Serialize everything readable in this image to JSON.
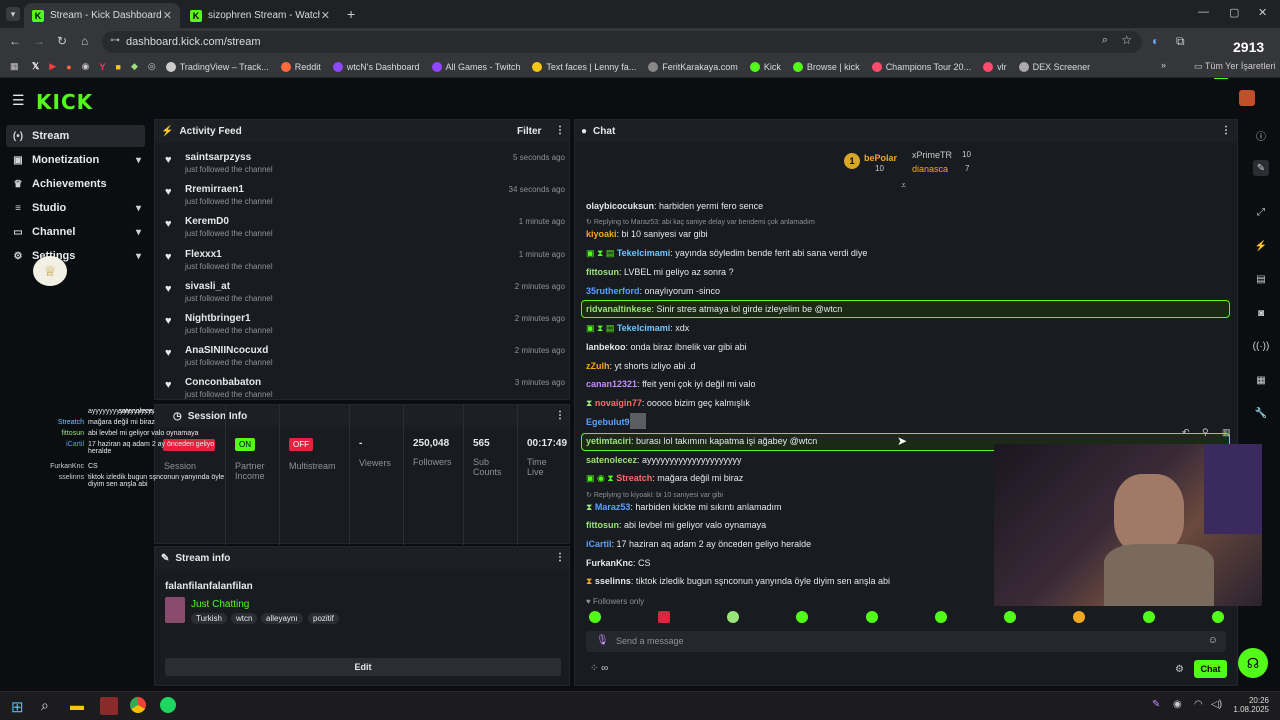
{
  "browser": {
    "tabs": [
      {
        "title": "Stream - Kick Dashboard",
        "active": true
      },
      {
        "title": "sizophren Stream - Watch Live",
        "active": false
      }
    ],
    "url": "dashboard.kick.com/stream",
    "bookmarks": [
      "TradingView – Track...",
      "Reddit",
      "wtcN's Dashboard",
      "All Games - Twitch",
      "Text faces | Lenny fa...",
      "FeritKarakaya.com",
      "Kick",
      "Browse | kick",
      "Champions Tour 20...",
      "vlr",
      "DEX Screener"
    ],
    "all_bookmarks_label": "Tüm Yer İşaretleri",
    "overlay_count": "2913"
  },
  "brand": {
    "logo": "KICK",
    "accent": "#53fc18"
  },
  "sidebar": {
    "items": [
      {
        "label": "Stream",
        "icon": "radio-icon",
        "active": true
      },
      {
        "label": "Monetization",
        "icon": "money-icon",
        "chevron": true
      },
      {
        "label": "Achievements",
        "icon": "trophy-icon"
      },
      {
        "label": "Studio",
        "icon": "sliders-icon",
        "chevron": true
      },
      {
        "label": "Channel",
        "icon": "tv-icon",
        "chevron": true
      },
      {
        "label": "Settings",
        "icon": "gear-icon",
        "chevron": true
      }
    ]
  },
  "activity_feed": {
    "title": "Activity Feed",
    "filter_label": "Filter",
    "items": [
      {
        "name": "saintsarpzyss",
        "action": "just followed the channel",
        "time": "5 seconds ago"
      },
      {
        "name": "Rremirraen1",
        "action": "just followed the channel",
        "time": "34 seconds ago"
      },
      {
        "name": "KeremD0",
        "action": "just followed the channel",
        "time": "1 minute ago"
      },
      {
        "name": "Flexxx1",
        "action": "just followed the channel",
        "time": "1 minute ago"
      },
      {
        "name": "sivasli_at",
        "action": "just followed the channel",
        "time": "2 minutes ago"
      },
      {
        "name": "Nightbringer1",
        "action": "just followed the channel",
        "time": "2 minutes ago"
      },
      {
        "name": "AnaSINIINcocuxd",
        "action": "just followed the channel",
        "time": "2 minutes ago"
      },
      {
        "name": "Conconbabaton",
        "action": "just followed the channel",
        "time": "3 minutes ago"
      }
    ]
  },
  "session_info": {
    "title": "Session Info",
    "stats": [
      {
        "label": "Session",
        "value": ""
      },
      {
        "label": "Partner Income",
        "value": "ON"
      },
      {
        "label": "Multistream",
        "value": "OFF"
      },
      {
        "label": "Viewers",
        "value": "-"
      },
      {
        "label": "Followers",
        "value": "250,048"
      },
      {
        "label": "Sub Counts",
        "value": "565"
      },
      {
        "label": "Time Live",
        "value": "00:17:49"
      }
    ]
  },
  "stream_info": {
    "title": "Stream info",
    "stream_title": "falanfilanfalanfilan",
    "category": "Just Chatting",
    "tags": [
      "Turkish",
      "wtcn",
      "alleyaynı",
      "pozitif"
    ],
    "edit_label": "Edit"
  },
  "overlay_chat": [
    {
      "name": "satenolecez",
      "msg": "ayyyyyyyyyyyyyyyyyyy"
    },
    {
      "name": "Streatch",
      "msg": "mağara değil mi biraz"
    },
    {
      "name": "fittosun",
      "msg": "abi levbel mi geliyor valo oynamaya"
    },
    {
      "name": "iCartil",
      "msg": "17 haziran aq adam 2 ay önceden geliyo heralde"
    },
    {
      "name": "FurkanKnc",
      "msg": "CS"
    },
    {
      "name": "sselinns",
      "msg": "tiktok izledik bugun sşnconun yanyında öyle diyim sen anşla abi"
    }
  ],
  "chat": {
    "title": "Chat",
    "leaderboard": [
      {
        "rank": "1",
        "name": "bePolar",
        "value": "10"
      },
      {
        "name": "xPrimeTR",
        "value": "10"
      },
      {
        "name": "dianasca",
        "value": "7"
      }
    ],
    "messages": [
      {
        "user": "olaybicocuksun",
        "text": "harbiden yermi fero sence",
        "color": "#e6e8ea"
      },
      {
        "reply": "Replying to Maraz53: abi kaç saniye delay var bendemi çok anlamadım"
      },
      {
        "user": "kiyoaki",
        "text": "bi 10 saniyesi var gibi",
        "color": "#f5a623"
      },
      {
        "user": "Tekelcimami",
        "text": "yayında söyledim bende ferit abi sana verdi diye",
        "color": "#6ec6ff"
      },
      {
        "user": "fittosun",
        "text": "LVBEL mi geliyo az sonra ?",
        "color": "#9be37a"
      },
      {
        "user": "35rutherford",
        "text": "onaylıyorum -sinco",
        "color": "#5aa0ff"
      },
      {
        "user": "ridvanaltinkese",
        "text": "Sinir stres atmaya lol girde izleyelim be @wtcn",
        "color": "#9be37a",
        "highlight": true
      },
      {
        "user": "Tekelcimami",
        "text": "xdx",
        "color": "#6ec6ff"
      },
      {
        "user": "lanbekoo",
        "text": "onda biraz ibnelik var gibi abi",
        "color": "#e6e8ea"
      },
      {
        "user": "zZulh",
        "text": "yt shorts izliyo abi .d",
        "color": "#f5a623"
      },
      {
        "user": "canan12321",
        "text": "ffeit yeni çok iyi değil mi valo",
        "color": "#c58cff"
      },
      {
        "user": "novaigin77",
        "text": "ooooo bizim geç kalmışlık",
        "color": "#ff6b6b"
      },
      {
        "user": "Egebulut9",
        "text": "",
        "color": "#5aa0ff"
      },
      {
        "user": "yetimtaciri",
        "text": "burası lol takımını kapatma işi ağabey @wtcn",
        "color": "#9be37a",
        "highlight": true
      },
      {
        "user": "satenolecez",
        "text": "ayyyyyyyyyyyyyyyyyyyyy",
        "color": "#9be37a"
      },
      {
        "user": "Streatch",
        "text": "mağara değil mi biraz",
        "color": "#ff6b6b"
      },
      {
        "reply": "Replying to kiyoaki: bi 10 saniyesi var gibi"
      },
      {
        "user": "Maraz53",
        "text": "harbiden kickte mi sıkıntı anlamadım",
        "color": "#5aa0ff"
      },
      {
        "user": "fittosun",
        "text": "abi levbel mi geliyor valo oynamaya",
        "color": "#9be37a"
      },
      {
        "user": "iCartil",
        "text": "17 haziran aq adam 2 ay önceden geliyo heralde",
        "color": "#5aa0ff"
      },
      {
        "user": "FurkanKnc",
        "text": "CS",
        "color": "#e6e8ea"
      },
      {
        "user": "sselinns",
        "text": "tiktok izledik bugun sşnconun yanyında öyle diyim sen anşla abi",
        "color": "#e6e8ea"
      }
    ],
    "followers_only": "Followers only",
    "input_placeholder": "Send a message",
    "send_label": "Chat"
  },
  "taskbar": {
    "time": "20:26",
    "date": "1.08.2025"
  }
}
